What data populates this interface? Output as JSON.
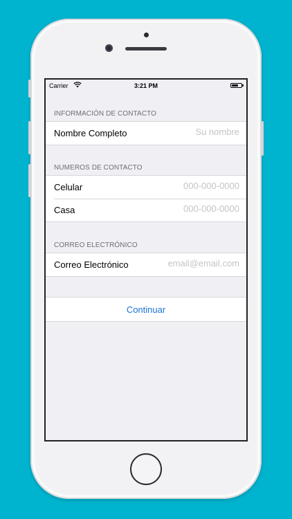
{
  "status_bar": {
    "carrier": "Carrier",
    "time": "3:21 PM"
  },
  "form": {
    "contact_section": {
      "header": "INFORMACIÓN DE CONTACTO",
      "rows": [
        {
          "label": "Nombre Completo",
          "placeholder": "Su nombre"
        }
      ]
    },
    "phones_section": {
      "header": "NUMEROS DE CONTACTO",
      "rows": [
        {
          "label": "Celular",
          "placeholder": "000-000-0000"
        },
        {
          "label": "Casa",
          "placeholder": "000-000-0000"
        }
      ]
    },
    "email_section": {
      "header": "CORREO ELECTRÓNICO",
      "rows": [
        {
          "label": "Correo Electrónico",
          "placeholder": "email@email.com"
        }
      ]
    },
    "continue_label": "Continuar"
  },
  "colors": {
    "background": "#00b4cf",
    "accent": "#1a73d8",
    "screen_bg": "#efeff4"
  }
}
